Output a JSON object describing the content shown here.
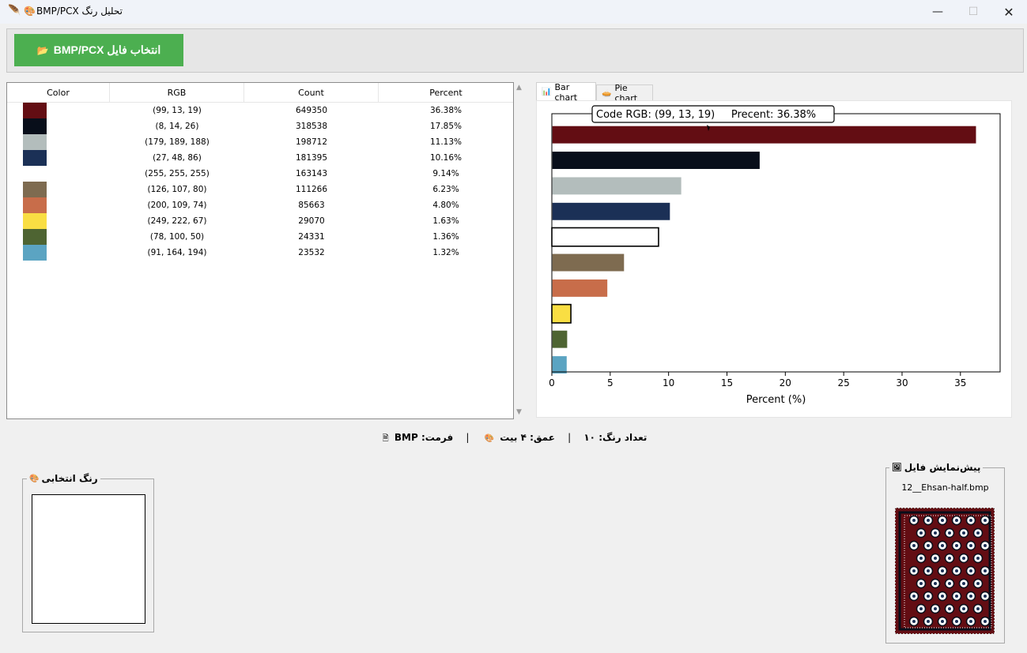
{
  "window": {
    "title": "تحلیل رنگ BMP/PCX",
    "icons": [
      "feather-icon",
      "palette-icon"
    ],
    "minimize": "—",
    "maximize": "☐",
    "close": "✕"
  },
  "toolbar": {
    "pick_button": "انتخاب فایل BMP/PCX",
    "pick_icon": "📂"
  },
  "table": {
    "headers": [
      "Color",
      "RGB",
      "Count",
      "Percent"
    ],
    "rows": [
      {
        "color": "#630d13",
        "rgb": "(99, 13, 19)",
        "count": "649350",
        "percent": "36.38%"
      },
      {
        "color": "#080e1a",
        "rgb": "(8, 14, 26)",
        "count": "318538",
        "percent": "17.85%"
      },
      {
        "color": "#b3bdbc",
        "rgb": "(179, 189, 188)",
        "count": "198712",
        "percent": "11.13%"
      },
      {
        "color": "#1b3056",
        "rgb": "(27, 48, 86)",
        "count": "181395",
        "percent": "10.16%"
      },
      {
        "color": "#ffffff",
        "rgb": "(255, 255, 255)",
        "count": "163143",
        "percent": "9.14%"
      },
      {
        "color": "#7e6b50",
        "rgb": "(126, 107, 80)",
        "count": "111266",
        "percent": "6.23%"
      },
      {
        "color": "#c86d4a",
        "rgb": "(200, 109, 74)",
        "count": "85663",
        "percent": "4.80%"
      },
      {
        "color": "#f9de43",
        "rgb": "(249, 222, 67)",
        "count": "29070",
        "percent": "1.63%"
      },
      {
        "color": "#4e6432",
        "rgb": "(78, 100, 50)",
        "count": "24331",
        "percent": "1.36%"
      },
      {
        "color": "#5ba4c2",
        "rgb": "(91, 164, 194)",
        "count": "23532",
        "percent": "1.32%"
      }
    ]
  },
  "tabs": {
    "bar": "Bar chart",
    "pie": "Pie chart"
  },
  "chart_data": {
    "type": "bar",
    "orientation": "horizontal",
    "categories": [
      "(99, 13, 19)",
      "(8, 14, 26)",
      "(179, 189, 188)",
      "(27, 48, 86)",
      "(255, 255, 255)",
      "(126, 107, 80)",
      "(200, 109, 74)",
      "(249, 222, 67)",
      "(78, 100, 50)",
      "(91, 164, 194)"
    ],
    "values": [
      36.38,
      17.85,
      11.13,
      10.16,
      9.14,
      6.23,
      4.8,
      1.63,
      1.36,
      1.32
    ],
    "colors": [
      "#630d13",
      "#080e1a",
      "#b3bdbc",
      "#1b3056",
      "#ffffff",
      "#7e6b50",
      "#c86d4a",
      "#f9de43",
      "#4e6432",
      "#5ba4c2"
    ],
    "xlabel": "Percent (%)",
    "xlim": [
      0,
      38.4
    ],
    "xticks": [
      0,
      5,
      10,
      15,
      20,
      25,
      30,
      35
    ],
    "tooltip": "Code RGB: (99, 13, 19)     Precent: 36.38%",
    "grid": false
  },
  "status": {
    "colors": "تعداد رنگ: ۱۰",
    "depth": "عمق: ۴ بیت",
    "format": "فرمت: BMP",
    "sep": "|"
  },
  "selected": {
    "title": "رنگ انتخابی",
    "color": "#ffffff"
  },
  "preview": {
    "title": "پیش‌نمایش فایل",
    "filename": "12__Ehsan-half.bmp"
  }
}
